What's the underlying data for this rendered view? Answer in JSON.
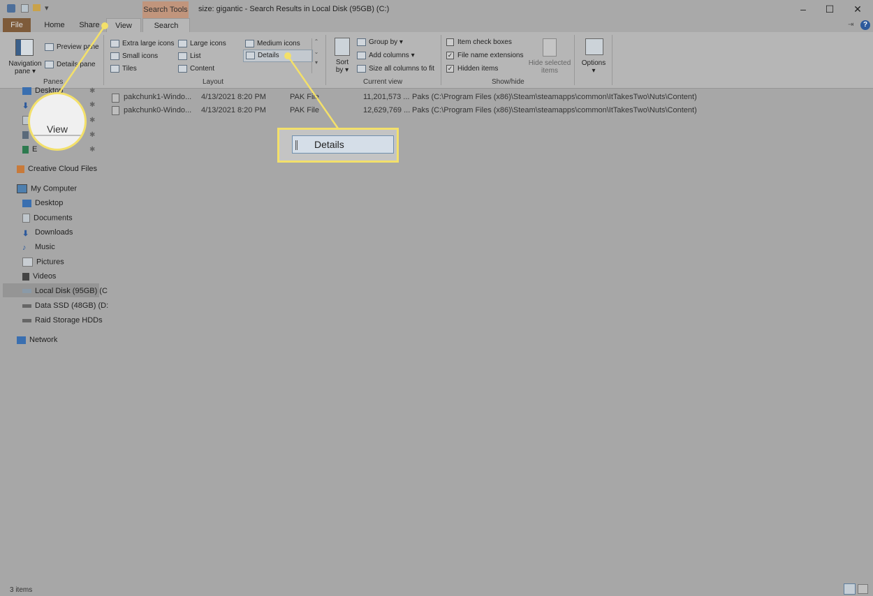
{
  "window": {
    "title": "size: gigantic - Search Results in Local Disk (95GB) (C:)",
    "context_tab": "Search Tools",
    "minimize_icon": "minimize-icon",
    "maximize_icon": "maximize-icon",
    "close_icon": "close-icon"
  },
  "tabs": {
    "file": "File",
    "home": "Home",
    "share": "Share",
    "view": "View",
    "search": "Search"
  },
  "ribbon": {
    "panes": {
      "label": "Panes",
      "navigation_pane_line1": "Navigation",
      "navigation_pane_line2": "pane ▾",
      "preview_pane": "Preview pane",
      "details_pane": "Details pane"
    },
    "layout": {
      "label": "Layout",
      "items": [
        "Extra large icons",
        "Large icons",
        "Medium icons",
        "Small icons",
        "List",
        "Details",
        "Tiles",
        "Content"
      ]
    },
    "current_view": {
      "label": "Current view",
      "sort_line1": "Sort",
      "sort_line2": "by ▾",
      "group_by": "Group by ▾",
      "add_columns": "Add columns ▾",
      "size_all_columns": "Size all columns to fit"
    },
    "show_hide": {
      "label": "Show/hide",
      "item_check_boxes": "Item check boxes",
      "file_name_extensions": "File name extensions",
      "hidden_items": "Hidden items",
      "hide_selected_line1": "Hide selected",
      "hide_selected_line2": "items"
    },
    "options": {
      "label": "Options",
      "arrow": "▾"
    }
  },
  "nav": {
    "quick_access": [
      "Desktop",
      "Do",
      "",
      "",
      "E"
    ],
    "creative_cloud": "Creative Cloud Files",
    "my_computer": "My Computer",
    "computer_items": [
      "Desktop",
      "Documents",
      "Downloads",
      "Music",
      "Pictures",
      "Videos",
      "Local Disk (95GB) (C",
      "Data SSD (48GB) (D:",
      "Raid Storage HDDs"
    ],
    "network": "Network"
  },
  "files": [
    {
      "name": "pakchunk1-Windo...",
      "date": "4/13/2021 8:20 PM",
      "type": "PAK File",
      "size": "11,201,573 ...",
      "folder": "Paks (C:\\Program Files (x86)\\Steam\\steamapps\\common\\ItTakesTwo\\Nuts\\Content)"
    },
    {
      "name": "pakchunk0-Windo...",
      "date": "4/13/2021 8:20 PM",
      "type": "PAK File",
      "size": "12,629,769 ...",
      "folder": "Paks (C:\\Program Files (x86)\\Steam\\steamapps\\common\\ItTakesTwo\\Nuts\\Content)"
    }
  ],
  "callouts": {
    "view": "View",
    "details": "Details"
  },
  "status": {
    "items": "3 items"
  },
  "colors": {
    "highlight": "#f3e06a",
    "file_tab": "#7e5b3a",
    "search_tools": "#c1957c"
  }
}
